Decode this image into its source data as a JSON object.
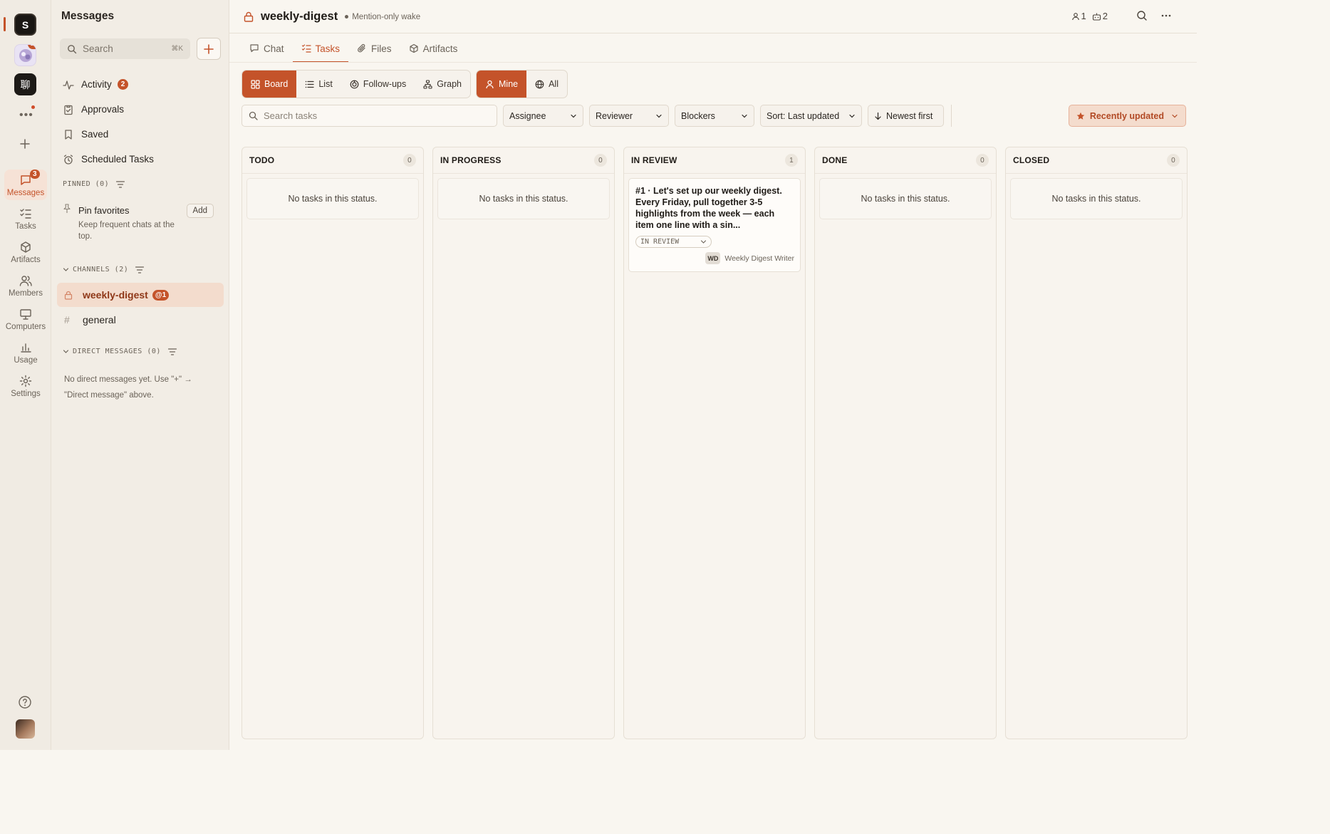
{
  "rail": {
    "workspace_initial": "S",
    "workspace_badge": "23",
    "workspace_glyph": "聊",
    "more_label": "•••",
    "nav": [
      {
        "id": "messages",
        "label": "Messages",
        "icon": "chat-bubble-icon",
        "badge": "3",
        "active": true
      },
      {
        "id": "tasks",
        "label": "Tasks",
        "icon": "checklist-icon"
      },
      {
        "id": "artifacts",
        "label": "Artifacts",
        "icon": "cube-icon"
      },
      {
        "id": "members",
        "label": "Members",
        "icon": "people-icon"
      },
      {
        "id": "computers",
        "label": "Computers",
        "icon": "monitor-icon"
      },
      {
        "id": "usage",
        "label": "Usage",
        "icon": "bar-chart-icon"
      },
      {
        "id": "settings",
        "label": "Settings",
        "icon": "gear-icon"
      }
    ]
  },
  "sidebar": {
    "title": "Messages",
    "search": {
      "placeholder": "Search",
      "shortcut": "⌘K"
    },
    "nav": [
      {
        "label": "Activity",
        "icon": "activity-icon",
        "badge": "2"
      },
      {
        "label": "Approvals",
        "icon": "clipboard-check-icon"
      },
      {
        "label": "Saved",
        "icon": "bookmark-icon"
      },
      {
        "label": "Scheduled Tasks",
        "icon": "alarm-clock-icon"
      }
    ],
    "pinned": {
      "header": "PINNED (0)",
      "title": "Pin favorites",
      "description": "Keep frequent chats at the top.",
      "add_label": "Add"
    },
    "channels": {
      "header": "CHANNELS (2)",
      "items": [
        {
          "name": "weekly-digest",
          "badge": "@1",
          "private": true,
          "active": true
        },
        {
          "name": "general",
          "private": false
        }
      ]
    },
    "direct_messages": {
      "header": "DIRECT MESSAGES (0)",
      "empty_line1": "No direct messages yet. Use \"+\" →",
      "empty_line2": "\"Direct message\" above."
    }
  },
  "header": {
    "channel": "weekly-digest",
    "wake_mode": "Mention-only wake",
    "members_count": "1",
    "agents_count": "2"
  },
  "tabs": [
    {
      "label": "Chat",
      "icon": "chat-bubble-icon"
    },
    {
      "label": "Tasks",
      "icon": "checklist-icon",
      "active": true
    },
    {
      "label": "Files",
      "icon": "paperclip-icon"
    },
    {
      "label": "Artifacts",
      "icon": "cube-icon"
    }
  ],
  "views": {
    "layout": [
      {
        "label": "Board",
        "icon": "grid-icon",
        "active": true
      },
      {
        "label": "List",
        "icon": "list-icon"
      },
      {
        "label": "Follow-ups",
        "icon": "follow-up-icon"
      },
      {
        "label": "Graph",
        "icon": "graph-icon"
      }
    ],
    "scope": [
      {
        "label": "Mine",
        "icon": "user-icon",
        "active": true
      },
      {
        "label": "All",
        "icon": "globe-icon"
      }
    ]
  },
  "filters": {
    "search_placeholder": "Search tasks",
    "assignee": "Assignee",
    "reviewer": "Reviewer",
    "blockers": "Blockers",
    "sort": "Sort: Last updated",
    "order": "Newest first",
    "preset": "Recently updated"
  },
  "board": {
    "empty_text": "No tasks in this status.",
    "columns": [
      {
        "title": "TODO",
        "count": "0",
        "cards": []
      },
      {
        "title": "IN PROGRESS",
        "count": "0",
        "cards": []
      },
      {
        "title": "IN REVIEW",
        "count": "1",
        "cards": [
          {
            "title": "#1 · Let's set up our weekly digest. Every Friday, pull together 3-5 highlights from the week — each item one line with a sin...",
            "status": "IN REVIEW",
            "assignee_initials": "WD",
            "assignee_name": "Weekly Digest Writer"
          }
        ]
      },
      {
        "title": "DONE",
        "count": "0",
        "cards": []
      },
      {
        "title": "CLOSED",
        "count": "0",
        "cards": []
      }
    ]
  },
  "colors": {
    "accent": "#c4532a",
    "background": "#f9f6f0",
    "sidebar": "#f2ede5",
    "rail": "#f0ebe3"
  }
}
